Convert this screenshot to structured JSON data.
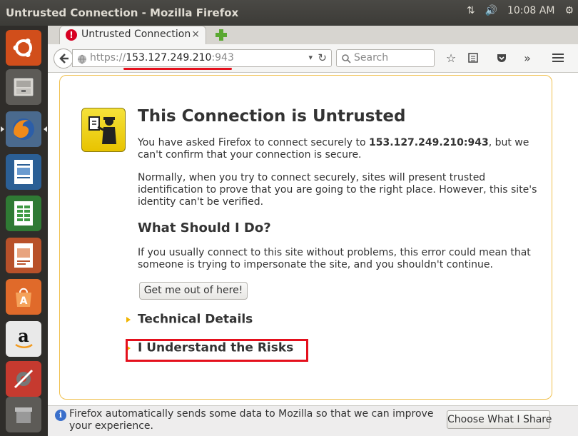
{
  "window": {
    "title": "Untrusted Connection - Mozilla Firefox"
  },
  "tray": {
    "time": "10:08 AM"
  },
  "launcher": {
    "items": [
      "ubuntu-dash-icon",
      "files-icon",
      "firefox-icon",
      "writer-icon",
      "calc-icon",
      "impress-icon",
      "software-center-icon",
      "amazon-icon",
      "system-settings-icon",
      "trash-icon"
    ]
  },
  "tab": {
    "label": "Untrusted Connection",
    "close": "×"
  },
  "urlbar": {
    "scheme": "https://",
    "host": "153.127.249.210",
    "port": ":943"
  },
  "search": {
    "placeholder": "Search"
  },
  "page": {
    "heading": "This Connection is Untrusted",
    "p1_pre": "You have asked Firefox to connect securely to ",
    "p1_host": "153.127.249.210:943",
    "p1_post": ", but we can't confirm that your connection is secure.",
    "p2": "Normally, when you try to connect securely, sites will present trusted identification to prove that you are going to the right place. However, this site's identity can't be verified.",
    "subheading": "What Should I Do?",
    "p3": "If you usually connect to this site without problems, this error could mean that someone is trying to impersonate the site, and you shouldn't continue.",
    "button": "Get me out of here!",
    "technical": "Technical Details",
    "risks": "I Understand the Risks"
  },
  "notification": {
    "text": "Firefox automatically sends some data to Mozilla so that we can improve your experience.",
    "button": "Choose What I Share"
  },
  "colors": {
    "accent_red": "#e4101d",
    "warning_yellow": "#f0c04d",
    "launcher_bg": "#2f2d2a"
  }
}
